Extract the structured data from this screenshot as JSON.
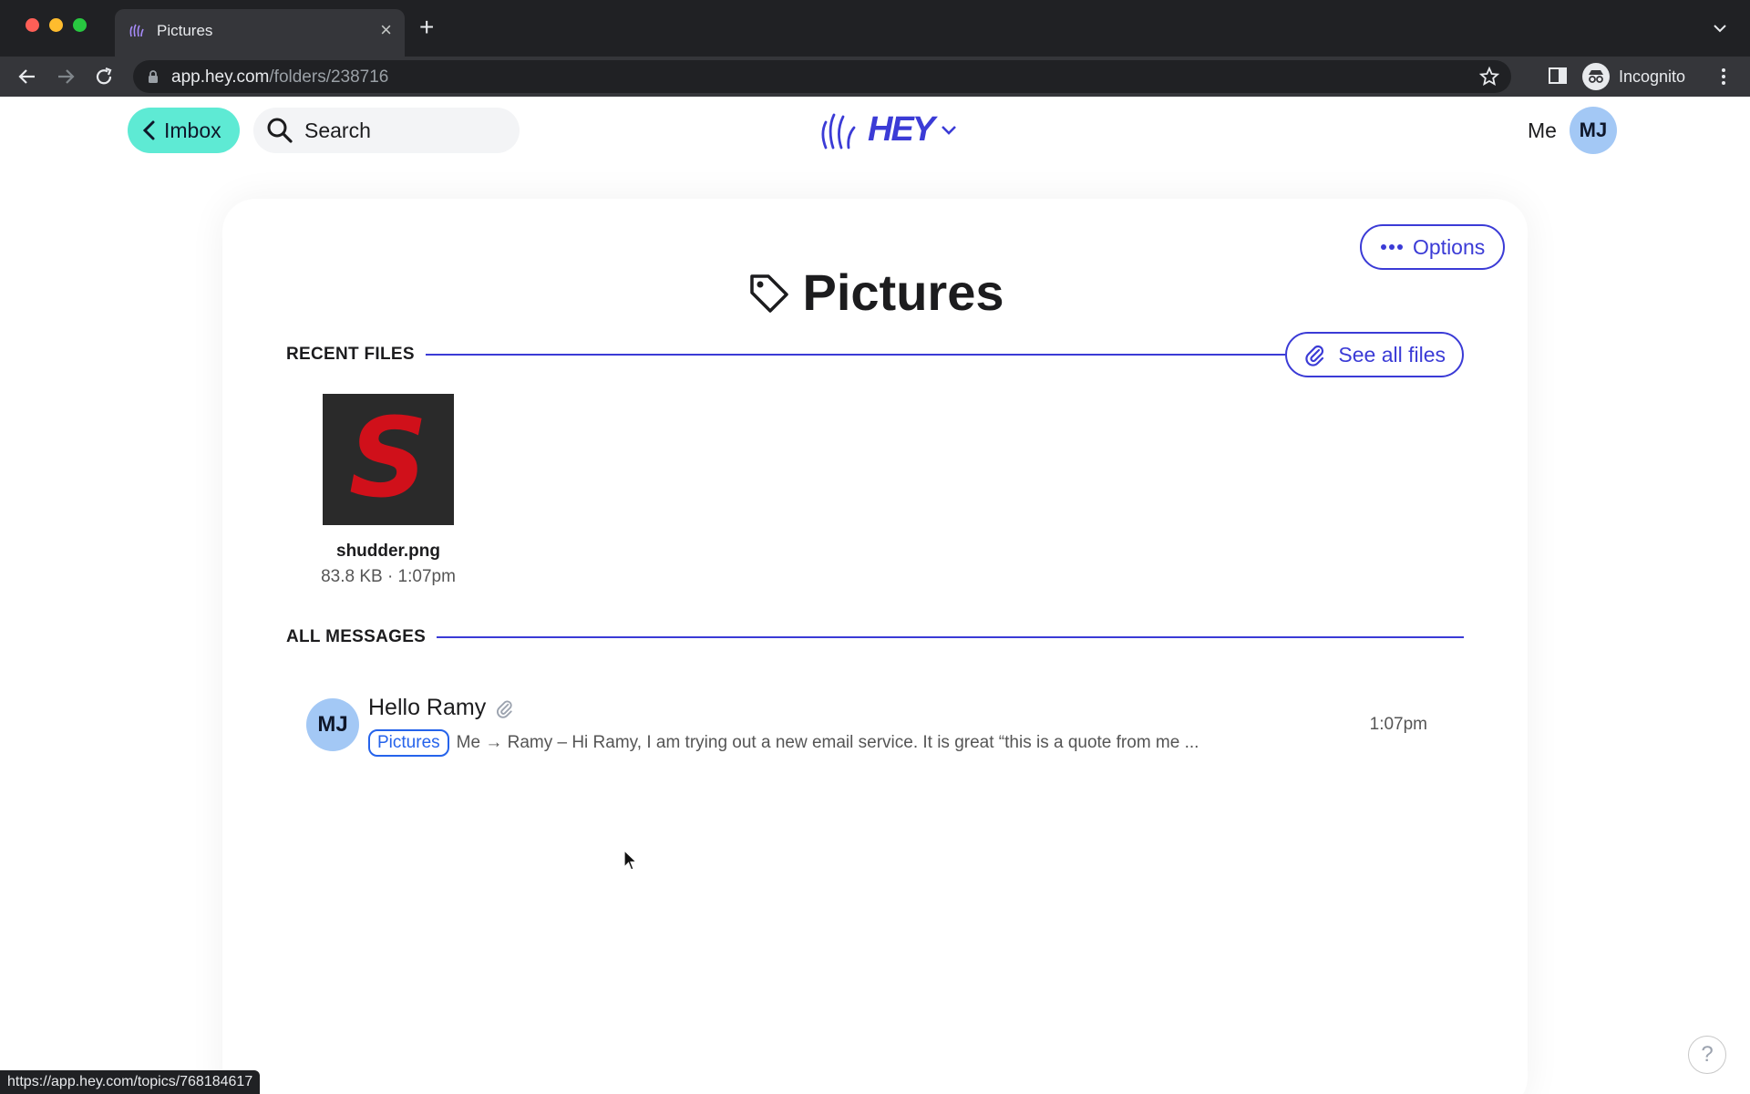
{
  "browser": {
    "tab_title": "Pictures",
    "tab_close": "×",
    "new_tab": "+",
    "url_host": "app.hey.com",
    "url_path": "/folders/238716",
    "profile_label": "Incognito",
    "status_url": "https://app.hey.com/topics/768184617"
  },
  "header": {
    "back_label": "Imbox",
    "search_label": "Search",
    "logo_text": "HEY",
    "me_label": "Me",
    "avatar_initials": "MJ"
  },
  "folder": {
    "title": "Pictures",
    "options_label": "Options"
  },
  "recent_files": {
    "heading": "RECENT FILES",
    "see_all_label": "See all files",
    "items": [
      {
        "name": "shudder.png",
        "meta": "83.8 KB · 1:07pm",
        "thumb_letter": "S"
      }
    ]
  },
  "messages": {
    "heading": "ALL MESSAGES",
    "items": [
      {
        "initials": "MJ",
        "subject": "Hello Ramy",
        "tag": "Pictures",
        "preview": "Me → Ramy – Hi Ramy, I am trying out a new email service. It is great “this is a quote from me ...",
        "time": "1:07pm"
      }
    ]
  },
  "help_label": "?",
  "colors": {
    "accent": "#3b3bd6",
    "imbox_button": "#5eead4",
    "avatar": "#a3c8f5",
    "tag": "#2563eb"
  }
}
